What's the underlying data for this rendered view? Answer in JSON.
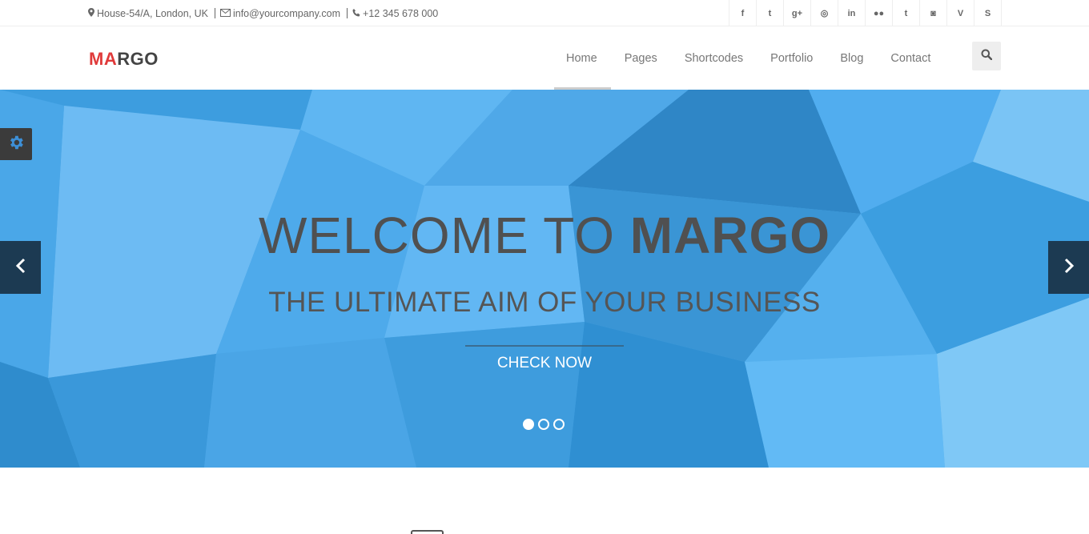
{
  "topbar": {
    "address": "House-54/A, London, UK",
    "email": "info@yourcompany.com",
    "phone": "+12 345 678 000",
    "socials": [
      {
        "icon": "facebook-icon",
        "glyph": "f"
      },
      {
        "icon": "twitter-icon",
        "glyph": "t"
      },
      {
        "icon": "google-plus-icon",
        "glyph": "g+"
      },
      {
        "icon": "dribbble-icon",
        "glyph": "◎"
      },
      {
        "icon": "linkedin-icon",
        "glyph": "in"
      },
      {
        "icon": "flickr-icon",
        "glyph": "●●"
      },
      {
        "icon": "tumblr-icon",
        "glyph": "t"
      },
      {
        "icon": "instagram-icon",
        "glyph": "◙"
      },
      {
        "icon": "vimeo-icon",
        "glyph": "V"
      },
      {
        "icon": "skype-icon",
        "glyph": "S"
      }
    ]
  },
  "header": {
    "logo_red": "MA",
    "logo_dark": "RGO",
    "nav": [
      "Home",
      "Pages",
      "Shortcodes",
      "Portfolio",
      "Blog",
      "Contact"
    ],
    "active_nav": "Home"
  },
  "hero": {
    "headline_light": "WELCOME TO ",
    "headline_bold": "MARGO",
    "subline": "THE ULTIMATE AIM OF YOUR BUSINESS",
    "cta": "CHECK NOW",
    "slides_total": 3,
    "slide_active": 1
  },
  "colors": {
    "brand_red": "#e03a3a",
    "hero_blue": "#4aa6e3",
    "arrow_bg": "#1c3a52"
  }
}
